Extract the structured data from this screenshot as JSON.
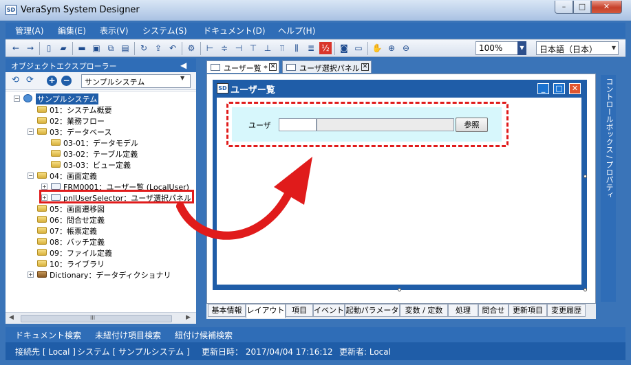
{
  "window": {
    "title": "VeraSym System Designer",
    "icon_text": "SD",
    "min_glyph": "–",
    "max_glyph": "□",
    "close_glyph": "✕"
  },
  "menu": [
    "管理(A)",
    "編集(E)",
    "表示(V)",
    "システム(S)",
    "ドキュメント(D)",
    "ヘルプ(H)"
  ],
  "toolbar": {
    "zoom": "100%",
    "language": "日本語（日本）",
    "icons": [
      "back-arrow-icon",
      "forward-arrow-icon",
      "panel-icon",
      "open-folder-icon",
      "folder-icon",
      "new-form-icon",
      "copy-icon",
      "paste-icon",
      "refresh-icon",
      "export-icon",
      "undo-icon",
      "settings-icon",
      "align-left-icon",
      "align-center-icon",
      "align-right-icon",
      "align-top-icon",
      "align-middle-icon",
      "align-bottom-icon",
      "distribute-horizontal-icon",
      "distribute-vertical-icon",
      "tab-order-icon",
      "camera-icon",
      "keyboard-icon",
      "hand-icon",
      "zoom-in-icon",
      "zoom-out-icon"
    ]
  },
  "explorer": {
    "title": "オブジェクトエクスプローラー",
    "pin_glyph": "◀",
    "add_glyph": "+",
    "remove_glyph": "−",
    "system_select": "サンプルシステム",
    "tree": [
      {
        "label": "サンプルシステム",
        "depth": 0,
        "exp": "−",
        "icon": "sys",
        "selected": true
      },
      {
        "label": "01：システム概要",
        "depth": 1,
        "exp": "",
        "icon": "folder"
      },
      {
        "label": "02：業務フロー",
        "depth": 1,
        "exp": "",
        "icon": "folder"
      },
      {
        "label": "03：データベース",
        "depth": 1,
        "exp": "−",
        "icon": "folder"
      },
      {
        "label": "03-01：データモデル",
        "depth": 2,
        "exp": "",
        "icon": "folder"
      },
      {
        "label": "03-02：テーブル定義",
        "depth": 2,
        "exp": "",
        "icon": "folder"
      },
      {
        "label": "03-03：ビュー定義",
        "depth": 2,
        "exp": "",
        "icon": "folder"
      },
      {
        "label": "04：画面定義",
        "depth": 1,
        "exp": "−",
        "icon": "folder"
      },
      {
        "label": "FRM0001：ユーザー覧 (LocalUser)",
        "depth": 2,
        "exp": "+",
        "icon": "panel"
      },
      {
        "label": "pnlUserSelector：ユーザ選択パネル",
        "depth": 2,
        "exp": "+",
        "icon": "panel"
      },
      {
        "label": "05：画面遷移図",
        "depth": 1,
        "exp": "",
        "icon": "folder"
      },
      {
        "label": "06：問合せ定義",
        "depth": 1,
        "exp": "",
        "icon": "folder"
      },
      {
        "label": "07：帳票定義",
        "depth": 1,
        "exp": "",
        "icon": "folder"
      },
      {
        "label": "08：バッチ定義",
        "depth": 1,
        "exp": "",
        "icon": "folder"
      },
      {
        "label": "09：ファイル定義",
        "depth": 1,
        "exp": "",
        "icon": "folder"
      },
      {
        "label": "10：ライブラリ",
        "depth": 1,
        "exp": "",
        "icon": "folder"
      },
      {
        "label": "Dictionary：データディクショナリ",
        "depth": 1,
        "exp": "+",
        "icon": "dict"
      }
    ],
    "scroll_left": "◀",
    "scroll_right": "▶",
    "scroll_grip": "III"
  },
  "designer": {
    "tabs": [
      "ユーザー覧 *",
      "ユーザ選択パネル"
    ],
    "tab_close": "✕",
    "form_icon": "SD",
    "form_title": "ユーザー覧",
    "user_label": "ユーザ",
    "ref_button": "参照",
    "bottom_tabs": [
      "基本情報",
      "レイアウト",
      "項目",
      "イベント",
      "起動パラメータ",
      "変数 / 定数",
      "処理",
      "問合せ",
      "更新項目",
      "変更履歴"
    ],
    "active_bottom_tab": "レイアウト"
  },
  "side_panel": "コントロールボックス / プロパティ",
  "links": [
    "ドキュメント検索",
    "未紐付け項目検索",
    "紐付け候補検索"
  ],
  "status": {
    "connection": "接続先 [ Local ]",
    "system": "システム [ サンプルシステム ]",
    "updated_at": "更新日時： 2017/04/04 17:16:12",
    "updated_by": "更新者: Local"
  },
  "colors": {
    "accent": "#2f6db7",
    "highlight_red": "#e01b1b",
    "panel_bg": "#d7f7fc"
  }
}
